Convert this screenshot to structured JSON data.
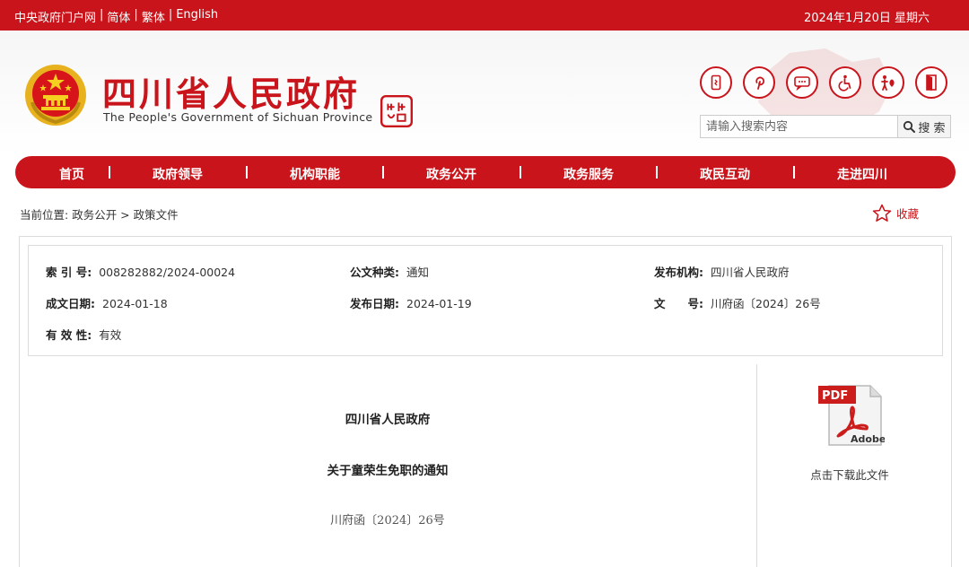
{
  "topbar": {
    "links": [
      "中央政府门户网",
      "简体",
      "繁体",
      "English"
    ],
    "separator": "|",
    "date": "2024年1月20日 星期六"
  },
  "header": {
    "title": "四川省人民政府",
    "subtitle": "The People's Government of Sichuan Province",
    "tool_icons": [
      "mobile-icon",
      "pinterest-icon",
      "chat-icon",
      "accessibility-icon",
      "elderly-care-icon",
      "exit-door-icon"
    ]
  },
  "search": {
    "placeholder": "请输入搜索内容",
    "button_label": "搜 索"
  },
  "nav": {
    "items": [
      "首页",
      "政府领导",
      "机构职能",
      "政务公开",
      "政务服务",
      "政民互动",
      "走进四川"
    ]
  },
  "breadcrumb": {
    "label": "当前位置:",
    "path": "政务公开 > 政策文件"
  },
  "favorite": {
    "label": "收藏"
  },
  "meta": {
    "index_no_label": "索 引 号:",
    "index_no": "008282882/2024-00024",
    "doc_type_label": "公文种类:",
    "doc_type": "通知",
    "issuer_label": "发布机构:",
    "issuer": "四川省人民政府",
    "created_label": "成文日期:",
    "created": "2024-01-18",
    "published_label": "发布日期:",
    "published": "2024-01-19",
    "doc_no_label": "文　　号:",
    "doc_no": "川府函〔2024〕26号",
    "validity_label": "有 效 性:",
    "validity": "有效"
  },
  "document": {
    "issuer": "四川省人民政府",
    "title": "关于童荣生免职的通知",
    "number": "川府函〔2024〕26号"
  },
  "download": {
    "pdf_text": "PDF",
    "adobe_text": "Adobe",
    "label": "点击下载此文件"
  },
  "colors": {
    "brand_red": "#c8141a",
    "border_gray": "#dcdcdc"
  }
}
